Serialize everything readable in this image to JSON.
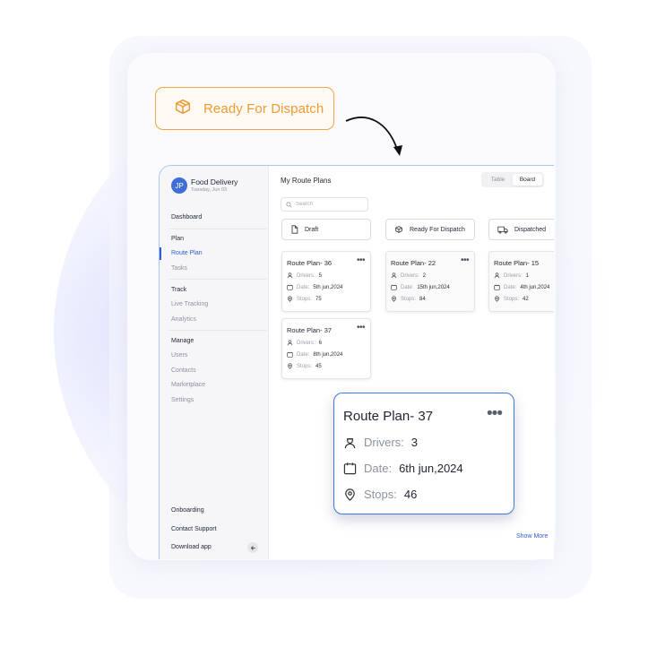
{
  "badge": {
    "label": "Ready For Dispatch",
    "icon": "box-icon",
    "color": "#ef9a35"
  },
  "sidebar": {
    "avatar_initials": "JP",
    "brand_title": "Food Delivery",
    "brand_date": "Tuesday, Jun 03",
    "items": [
      {
        "label": "Dashboard"
      },
      {
        "label": "Plan"
      },
      {
        "label": "Route Plan"
      },
      {
        "label": "Tasks"
      },
      {
        "label": "Track"
      },
      {
        "label": "Live Tracking"
      },
      {
        "label": "Analytics"
      },
      {
        "label": "Manage"
      },
      {
        "label": "Users"
      },
      {
        "label": "Contacts"
      },
      {
        "label": "Marketplace"
      },
      {
        "label": "Settings"
      },
      {
        "label": "Onboarding"
      },
      {
        "label": "Contact Support"
      },
      {
        "label": "Download app"
      }
    ]
  },
  "main": {
    "title": "My Route Plans",
    "toggle": {
      "table": "Table",
      "board": "Board",
      "selected": "Board"
    },
    "search_placeholder": "Search",
    "columns": [
      {
        "label": "Draft",
        "icon": "document-icon"
      },
      {
        "label": "Ready For Dispatch",
        "icon": "box-icon"
      },
      {
        "label": "Dispatched",
        "icon": "truck-icon"
      }
    ],
    "cards": [
      {
        "title": "Route Plan- 36",
        "drivers": "5",
        "date": "5th jun,2024",
        "stops": "75"
      },
      {
        "title": "Route Plan- 37",
        "drivers": "6",
        "date": "8th jun,2024",
        "stops": "45"
      },
      {
        "title": "Route Plan- 22",
        "drivers": "2",
        "date": "15th jun,2024",
        "stops": "84"
      },
      {
        "title": "Route Plan- 15",
        "drivers": "1",
        "date": "4th jun,2024",
        "stops": "42"
      }
    ],
    "labels": {
      "drivers": "Drivers:",
      "date": "Date:",
      "stops": "Stops:"
    },
    "show_more": "Show More"
  },
  "featured_card": {
    "title": "Route Plan- 37",
    "drivers": "3",
    "date": "6th jun,2024",
    "stops": "46"
  },
  "colors": {
    "accent": "#2f5fd0",
    "badge_border": "#f0a444",
    "featured_border": "#3d78e8"
  }
}
